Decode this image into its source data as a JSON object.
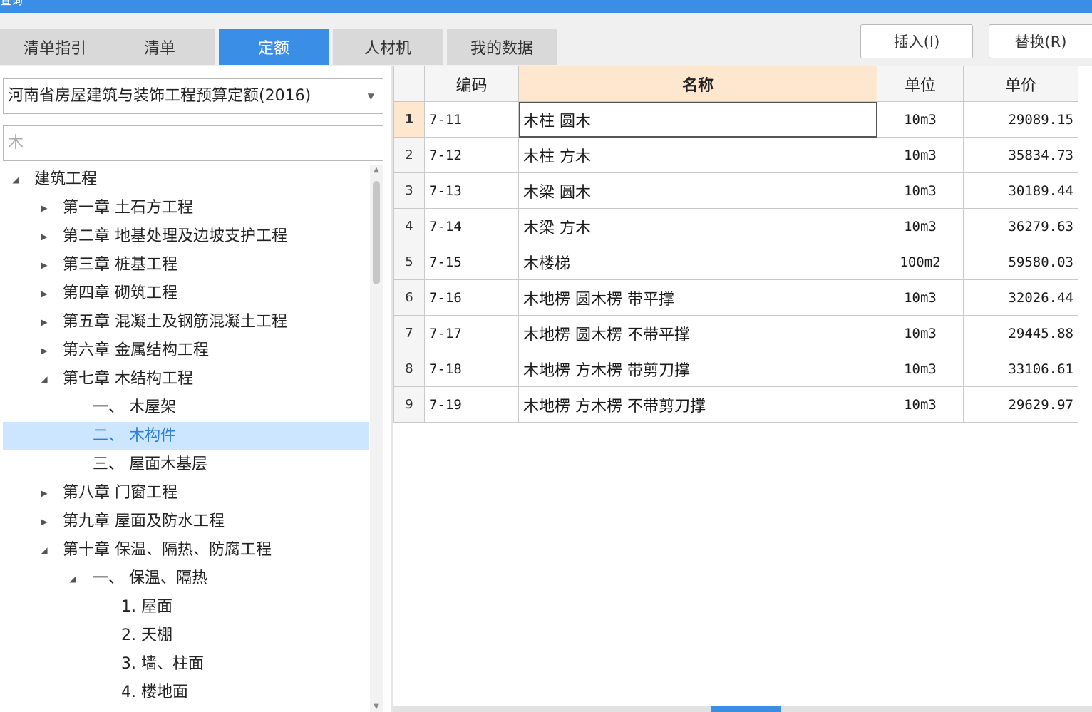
{
  "window": {
    "title": "查询"
  },
  "tabs": [
    {
      "label": "清单指引",
      "active": false
    },
    {
      "label": "清单",
      "active": false
    },
    {
      "label": "定额",
      "active": true
    },
    {
      "label": "人材机",
      "active": false
    },
    {
      "label": "我的数据",
      "active": false
    }
  ],
  "actions": {
    "insert_label": "插入(I)",
    "replace_label": "替换(R)"
  },
  "filter": {
    "quota_library": "河南省房屋建筑与装饰工程预算定额(2016)",
    "search_value": "木"
  },
  "tree": [
    {
      "label": "建筑工程",
      "level": 0,
      "toggle": "expanded"
    },
    {
      "label": "第一章 土石方工程",
      "level": 1,
      "toggle": "collapsed"
    },
    {
      "label": "第二章 地基处理及边坡支护工程",
      "level": 1,
      "toggle": "collapsed"
    },
    {
      "label": "第三章 桩基工程",
      "level": 1,
      "toggle": "collapsed"
    },
    {
      "label": "第四章 砌筑工程",
      "level": 1,
      "toggle": "collapsed"
    },
    {
      "label": "第五章 混凝土及钢筋混凝土工程",
      "level": 1,
      "toggle": "collapsed"
    },
    {
      "label": "第六章 金属结构工程",
      "level": 1,
      "toggle": "collapsed"
    },
    {
      "label": "第七章 木结构工程",
      "level": 1,
      "toggle": "expanded"
    },
    {
      "label": "一、  木屋架",
      "level": 2,
      "toggle": "none"
    },
    {
      "label": "二、  木构件",
      "level": 2,
      "toggle": "none",
      "selected": true
    },
    {
      "label": "三、  屋面木基层",
      "level": 2,
      "toggle": "none"
    },
    {
      "label": "第八章 门窗工程",
      "level": 1,
      "toggle": "collapsed"
    },
    {
      "label": "第九章 屋面及防水工程",
      "level": 1,
      "toggle": "collapsed"
    },
    {
      "label": "第十章 保温、隔热、防腐工程",
      "level": 1,
      "toggle": "expanded"
    },
    {
      "label": "一、  保温、隔热",
      "level": 2,
      "toggle": "expanded"
    },
    {
      "label": "1. 屋面",
      "level": 3,
      "toggle": "none"
    },
    {
      "label": "2. 天棚",
      "level": 3,
      "toggle": "none"
    },
    {
      "label": "3. 墙、柱面",
      "level": 3,
      "toggle": "none"
    },
    {
      "label": "4. 楼地面",
      "level": 3,
      "toggle": "none"
    }
  ],
  "grid": {
    "columns": {
      "code": "编码",
      "name": "名称",
      "unit": "单位",
      "price": "单价"
    },
    "rows": [
      {
        "no": "1",
        "code": "7-11",
        "name": "木柱 圆木",
        "unit": "10m3",
        "price": "29089.15"
      },
      {
        "no": "2",
        "code": "7-12",
        "name": "木柱 方木",
        "unit": "10m3",
        "price": "35834.73"
      },
      {
        "no": "3",
        "code": "7-13",
        "name": "木梁 圆木",
        "unit": "10m3",
        "price": "30189.44"
      },
      {
        "no": "4",
        "code": "7-14",
        "name": "木梁 方木",
        "unit": "10m3",
        "price": "36279.63"
      },
      {
        "no": "5",
        "code": "7-15",
        "name": "木楼梯",
        "unit": "100m2",
        "price": "59580.03"
      },
      {
        "no": "6",
        "code": "7-16",
        "name": "木地楞 圆木楞 带平撑",
        "unit": "10m3",
        "price": "32026.44"
      },
      {
        "no": "7",
        "code": "7-17",
        "name": "木地楞 圆木楞 不带平撑",
        "unit": "10m3",
        "price": "29445.88"
      },
      {
        "no": "8",
        "code": "7-18",
        "name": "木地楞 方木楞 带剪刀撑",
        "unit": "10m3",
        "price": "33106.61"
      },
      {
        "no": "9",
        "code": "7-19",
        "name": "木地楞 方木楞 不带剪刀撑",
        "unit": "10m3",
        "price": "29629.97"
      }
    ]
  },
  "colors": {
    "accent": "#3a8ee6",
    "selected_bg": "#cce6ff",
    "sorted_header": "#fde7cf"
  }
}
